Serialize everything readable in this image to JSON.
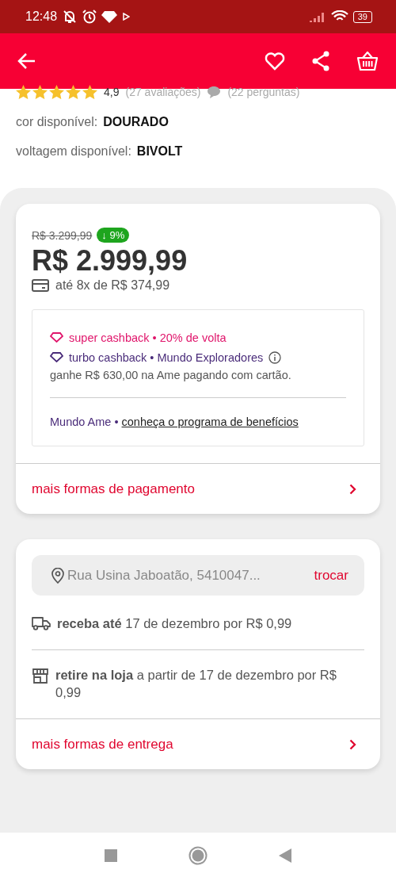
{
  "status_bar": {
    "time": "12:48",
    "battery": "39"
  },
  "header": {
    "actions": [
      {
        "kind": "favorite"
      },
      {
        "kind": "share"
      },
      {
        "kind": "basket"
      }
    ]
  },
  "rating": {
    "stars": 5,
    "score": "4,9",
    "reviews": "(27 avaliações)",
    "questions": "(22 perguntas)"
  },
  "options": [
    {
      "label": "cor disponível:",
      "value": "DOURADO"
    },
    {
      "label": "voltagem disponível:",
      "value": "BIVOLT"
    }
  ],
  "price_card": {
    "old_price": "R$ 3.299,99",
    "discount": "↓ 9%",
    "price": "R$ 2.999,99",
    "installments": "até 8x de R$ 374,99",
    "cashback": [
      {
        "kind": "super",
        "text": "super cashback • 20% de volta"
      },
      {
        "kind": "turbo",
        "text": "turbo cashback • Mundo Exploradores"
      }
    ],
    "cashback_note": "ganhe R$ 630,00 na Ame pagando com cartão.",
    "program_prefix": "Mundo Ame • ",
    "program_link": "conheça o programa de benefícios",
    "more_link": "mais formas de pagamento"
  },
  "delivery_card": {
    "address": "Rua Usina Jaboatão, 5410047...",
    "change": "trocar",
    "options": [
      {
        "kind": "shipping",
        "text": "**receba até** 17 de dezembro por R$ 0,99"
      },
      {
        "kind": "pickup",
        "text": "**retire na loja** a partir de 17 de dezembro por R$ 0,99"
      }
    ],
    "more_link": "mais formas de entrega"
  }
}
